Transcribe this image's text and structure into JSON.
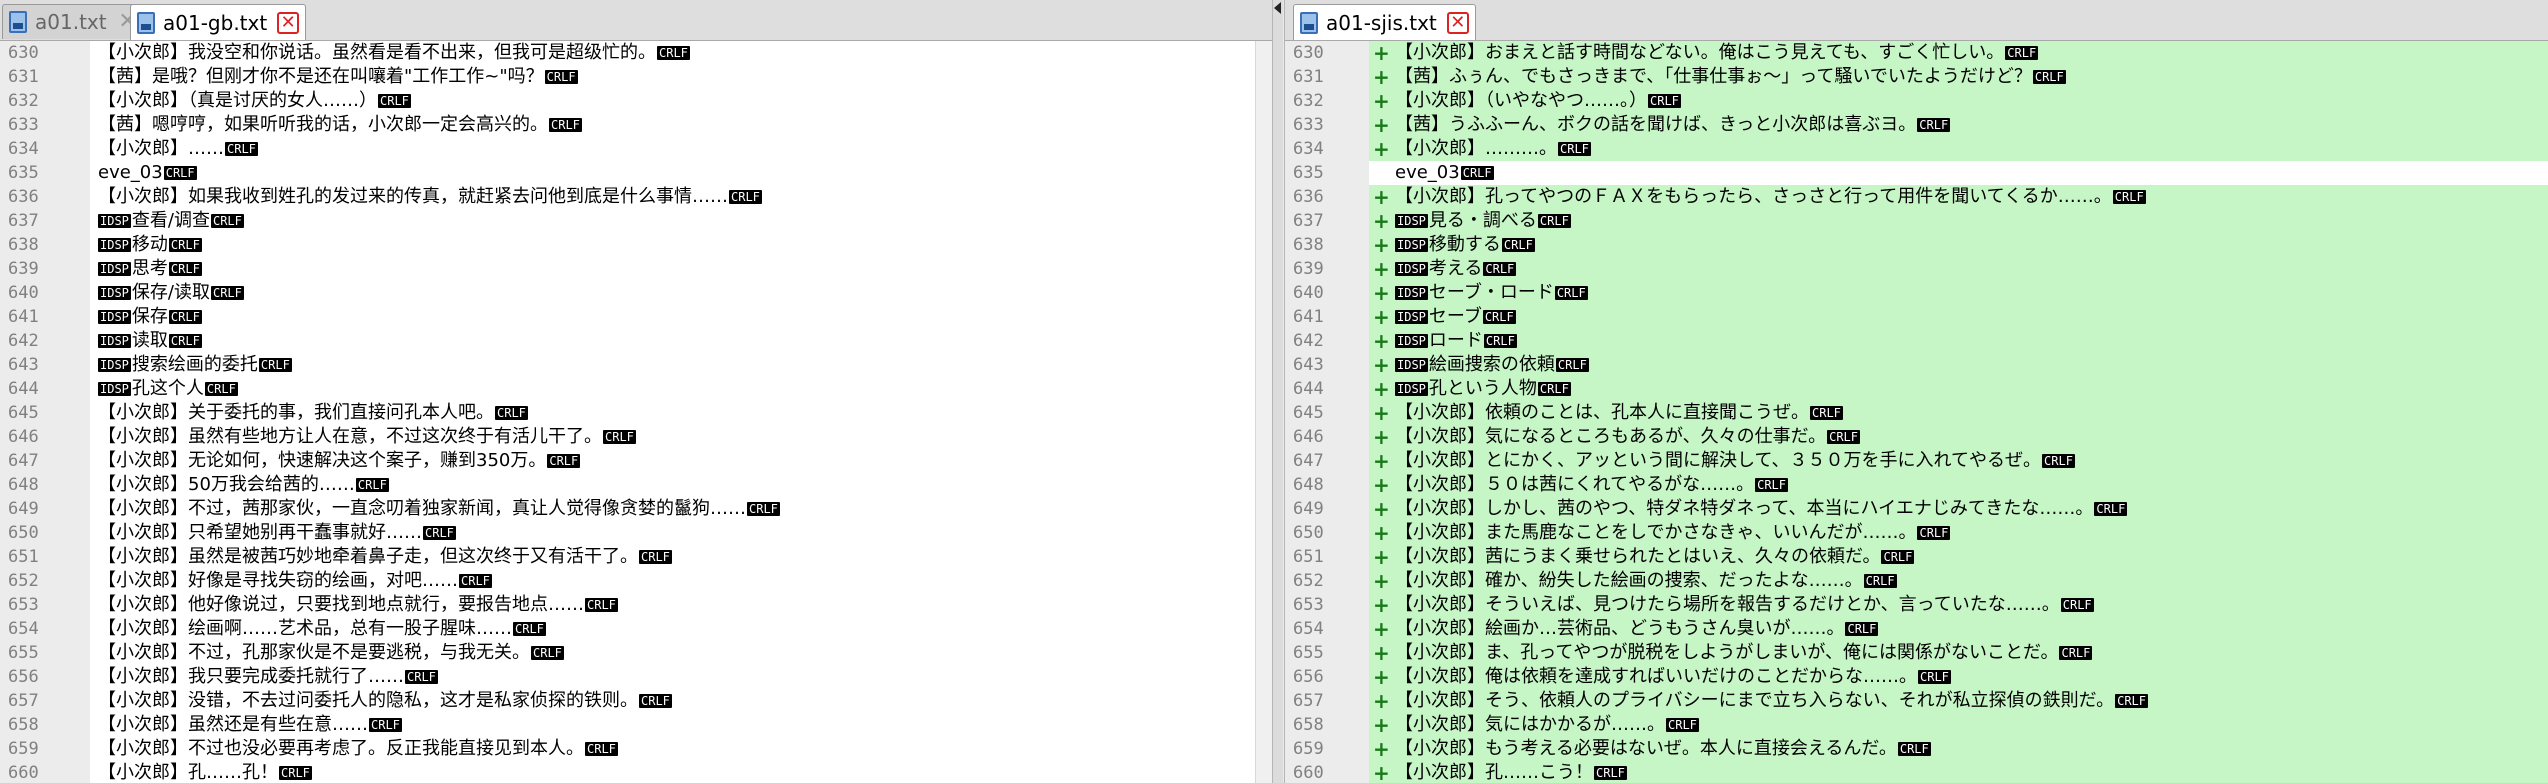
{
  "left": {
    "tabs": [
      {
        "label": "a01.txt",
        "active": false
      },
      {
        "label": "a01-gb.txt",
        "active": true
      }
    ],
    "eol_marker": "CRLF",
    "lines": [
      {
        "n": "630",
        "text": "【小次郎】我没空和你说话。虽然看是看不出来，但我可是超级忙的。"
      },
      {
        "n": "631",
        "text": "【茜】是哦？但刚才你不是还在叫嚷着\"工作工作~\"吗？"
      },
      {
        "n": "632",
        "text": "【小次郎】（真是讨厌的女人……）"
      },
      {
        "n": "633",
        "text": "【茜】嗯哼哼，如果听听我的话，小次郎一定会高兴的。"
      },
      {
        "n": "634",
        "text": "【小次郎】……"
      },
      {
        "n": "635",
        "text": "eve_03"
      },
      {
        "n": "636",
        "text": "【小次郎】如果我收到姓孔的发过来的传真，就赶紧去问他到底是什么事情……"
      },
      {
        "n": "637",
        "tag": "IDSP",
        "text": "查看/调查"
      },
      {
        "n": "638",
        "tag": "IDSP",
        "text": "移动"
      },
      {
        "n": "639",
        "tag": "IDSP",
        "text": "思考"
      },
      {
        "n": "640",
        "tag": "IDSP",
        "text": "保存/读取"
      },
      {
        "n": "641",
        "tag": "IDSP",
        "text": "保存"
      },
      {
        "n": "642",
        "tag": "IDSP",
        "text": "读取"
      },
      {
        "n": "643",
        "tag": "IDSP",
        "text": "搜索绘画的委托"
      },
      {
        "n": "644",
        "tag": "IDSP",
        "text": "孔这个人"
      },
      {
        "n": "645",
        "text": "【小次郎】关于委托的事，我们直接问孔本人吧。"
      },
      {
        "n": "646",
        "text": "【小次郎】虽然有些地方让人在意，不过这次终于有活儿干了。"
      },
      {
        "n": "647",
        "text": "【小次郎】无论如何，快速解决这个案子，赚到350万。"
      },
      {
        "n": "648",
        "text": "【小次郎】50万我会给茜的……"
      },
      {
        "n": "649",
        "text": "【小次郎】不过，茜那家伙，一直念叨着独家新闻，真让人觉得像贪婪的鬣狗……"
      },
      {
        "n": "650",
        "text": "【小次郎】只希望她别再干蠢事就好……"
      },
      {
        "n": "651",
        "text": "【小次郎】虽然是被茜巧妙地牵着鼻子走，但这次终于又有活干了。"
      },
      {
        "n": "652",
        "text": "【小次郎】好像是寻找失窃的绘画，对吧……"
      },
      {
        "n": "653",
        "text": "【小次郎】他好像说过，只要找到地点就行，要报告地点……"
      },
      {
        "n": "654",
        "text": "【小次郎】绘画啊……艺术品，总有一股子腥味……"
      },
      {
        "n": "655",
        "text": "【小次郎】不过，孔那家伙是不是要逃税，与我无关。"
      },
      {
        "n": "656",
        "text": "【小次郎】我只要完成委托就行了……"
      },
      {
        "n": "657",
        "text": "【小次郎】没错，不去过问委托人的隐私，这才是私家侦探的铁则。"
      },
      {
        "n": "658",
        "text": "【小次郎】虽然还是有些在意……"
      },
      {
        "n": "659",
        "text": "【小次郎】不过也没必要再考虑了。反正我能直接见到本人。"
      },
      {
        "n": "660",
        "text": "【小次郎】孔……孔！"
      }
    ]
  },
  "right": {
    "tabs": [
      {
        "label": "a01-sjis.txt",
        "active": true
      }
    ],
    "eol_marker": "CRLF",
    "diff_marker": "+",
    "colors": {
      "changed_bg": "#c6f5c6",
      "marker": "#1a7a1a"
    },
    "lines": [
      {
        "n": "630",
        "changed": true,
        "text": "【小次郎】おまえと話す時間などない。俺はこう見えても、すごく忙しい。"
      },
      {
        "n": "631",
        "changed": true,
        "text": "【茜】ふぅん、でもさっきまで、「仕事仕事ぉ～」って騒いでいたようだけど？"
      },
      {
        "n": "632",
        "changed": true,
        "text": "【小次郎】（いやなやつ……。）"
      },
      {
        "n": "633",
        "changed": true,
        "text": "【茜】うふふーん、ボクの話を聞けば、きっと小次郎は喜ぶヨ。"
      },
      {
        "n": "634",
        "changed": true,
        "text": "【小次郎】………。"
      },
      {
        "n": "635",
        "changed": false,
        "text": "eve_03"
      },
      {
        "n": "636",
        "changed": true,
        "text": "【小次郎】孔ってやつのＦＡＸをもらったら、さっさと行って用件を聞いてくるか……。"
      },
      {
        "n": "637",
        "changed": true,
        "tag": "IDSP",
        "text": "見る・調べる"
      },
      {
        "n": "638",
        "changed": true,
        "tag": "IDSP",
        "text": "移動する"
      },
      {
        "n": "639",
        "changed": true,
        "tag": "IDSP",
        "text": "考える"
      },
      {
        "n": "640",
        "changed": true,
        "tag": "IDSP",
        "text": "セーブ・ロード"
      },
      {
        "n": "641",
        "changed": true,
        "tag": "IDSP",
        "text": "セーブ"
      },
      {
        "n": "642",
        "changed": true,
        "tag": "IDSP",
        "text": "ロード"
      },
      {
        "n": "643",
        "changed": true,
        "tag": "IDSP",
        "text": "絵画捜索の依頼"
      },
      {
        "n": "644",
        "changed": true,
        "tag": "IDSP",
        "text": "孔という人物"
      },
      {
        "n": "645",
        "changed": true,
        "text": "【小次郎】依頼のことは、孔本人に直接聞こうぜ。"
      },
      {
        "n": "646",
        "changed": true,
        "text": "【小次郎】気になるところもあるが、久々の仕事だ。"
      },
      {
        "n": "647",
        "changed": true,
        "text": "【小次郎】とにかく、アッという間に解決して、３５０万を手に入れてやるぜ。"
      },
      {
        "n": "648",
        "changed": true,
        "text": "【小次郎】５０は茜にくれてやるがな……。"
      },
      {
        "n": "649",
        "changed": true,
        "text": "【小次郎】しかし、茜のやつ、特ダネ特ダネって、本当にハイエナじみてきたな……。"
      },
      {
        "n": "650",
        "changed": true,
        "text": "【小次郎】また馬鹿なことをしでかさなきゃ、いいんだが……。"
      },
      {
        "n": "651",
        "changed": true,
        "text": "【小次郎】茜にうまく乗せられたとはいえ、久々の依頼だ。"
      },
      {
        "n": "652",
        "changed": true,
        "text": "【小次郎】確か、紛失した絵画の捜索、だったよな……。"
      },
      {
        "n": "653",
        "changed": true,
        "text": "【小次郎】そういえば、見つけたら場所を報告するだけとか、言っていたな……。"
      },
      {
        "n": "654",
        "changed": true,
        "text": "【小次郎】絵画か…芸術品、どうもうさん臭いが……。"
      },
      {
        "n": "655",
        "changed": true,
        "text": "【小次郎】ま、孔ってやつが脱税をしようがしまいが、俺には関係がないことだ。"
      },
      {
        "n": "656",
        "changed": true,
        "text": "【小次郎】俺は依頼を達成すればいいだけのことだからな……。"
      },
      {
        "n": "657",
        "changed": true,
        "text": "【小次郎】そう、依頼人のプライバシーにまで立ち入らない、それが私立探偵の鉄則だ。"
      },
      {
        "n": "658",
        "changed": true,
        "text": "【小次郎】気にはかかるが……。"
      },
      {
        "n": "659",
        "changed": true,
        "text": "【小次郎】もう考える必要はないぜ。本人に直接会えるんだ。"
      },
      {
        "n": "660",
        "changed": true,
        "text": "【小次郎】孔……こう！"
      }
    ]
  }
}
